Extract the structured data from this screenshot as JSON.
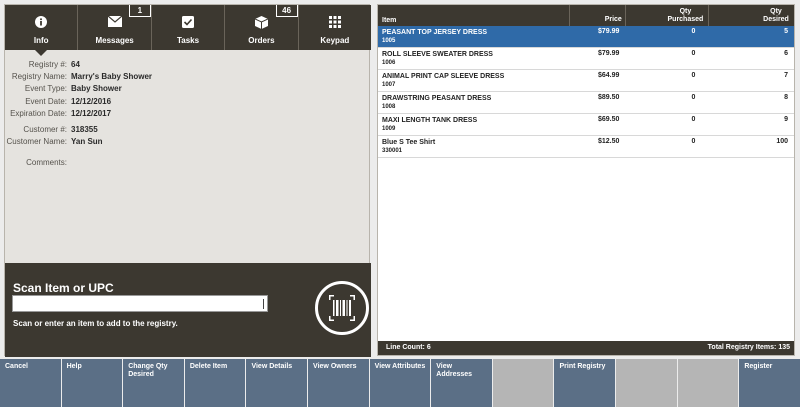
{
  "nav": {
    "tabs": [
      {
        "label": "Info",
        "icon": "info-icon",
        "badge": ""
      },
      {
        "label": "Messages",
        "icon": "envelope-icon",
        "badge": "1"
      },
      {
        "label": "Tasks",
        "icon": "checkbox-icon",
        "badge": ""
      },
      {
        "label": "Orders",
        "icon": "box-icon",
        "badge": "46"
      },
      {
        "label": "Keypad",
        "icon": "keypad-icon",
        "badge": ""
      }
    ]
  },
  "registry": {
    "registry_no_label": "Registry #:",
    "registry_no": "64",
    "registry_name_label": "Registry Name:",
    "registry_name": "Marry's Baby Shower",
    "event_type_label": "Event Type:",
    "event_type": "Baby Shower",
    "event_date_label": "Event Date:",
    "event_date": "12/12/2016",
    "expiration_date_label": "Expiration Date:",
    "expiration_date": "12/12/2017",
    "customer_no_label": "Customer #:",
    "customer_no": "318355",
    "customer_name_label": "Customer Name:",
    "customer_name": "Yan Sun",
    "comments_label": "Comments:"
  },
  "scan": {
    "title": "Scan Item or UPC",
    "help": "Scan or enter an item to add to the registry.",
    "value": ""
  },
  "table": {
    "headers": {
      "item": "Item",
      "price": "Price",
      "qty_purchased": "Qty Purchased",
      "qty_desired": "Qty Desired"
    },
    "rows": [
      {
        "name": "PEASANT TOP JERSEY DRESS",
        "sku": "1005",
        "price": "$79.99",
        "purchased": "0",
        "desired": "5"
      },
      {
        "name": "ROLL SLEEVE SWEATER DRESS",
        "sku": "1006",
        "price": "$79.99",
        "purchased": "0",
        "desired": "6"
      },
      {
        "name": "ANIMAL PRINT CAP SLEEVE DRESS",
        "sku": "1007",
        "price": "$64.99",
        "purchased": "0",
        "desired": "7"
      },
      {
        "name": "DRAWSTRING PEASANT DRESS",
        "sku": "1008",
        "price": "$89.50",
        "purchased": "0",
        "desired": "8"
      },
      {
        "name": "MAXI LENGTH TANK DRESS",
        "sku": "1009",
        "price": "$69.50",
        "purchased": "0",
        "desired": "9"
      },
      {
        "name": "Blue S Tee Shirt",
        "sku": "330001",
        "price": "$12.50",
        "purchased": "0",
        "desired": "100"
      }
    ],
    "line_count": "Line Count: 6",
    "total_items": "Total Registry Items: 135"
  },
  "toolbar": {
    "buttons": [
      "Cancel",
      "Help",
      "Change Qty Desired",
      "Delete Item",
      "View Details",
      "View Owners",
      "View Attributes",
      "View Addresses",
      "",
      "Print Registry",
      "",
      "",
      "Register"
    ]
  },
  "colors": {
    "dark": "#3c3830",
    "selected": "#2f6aa8",
    "button": "#5b6f86",
    "disabled": "#b5b5b5"
  }
}
